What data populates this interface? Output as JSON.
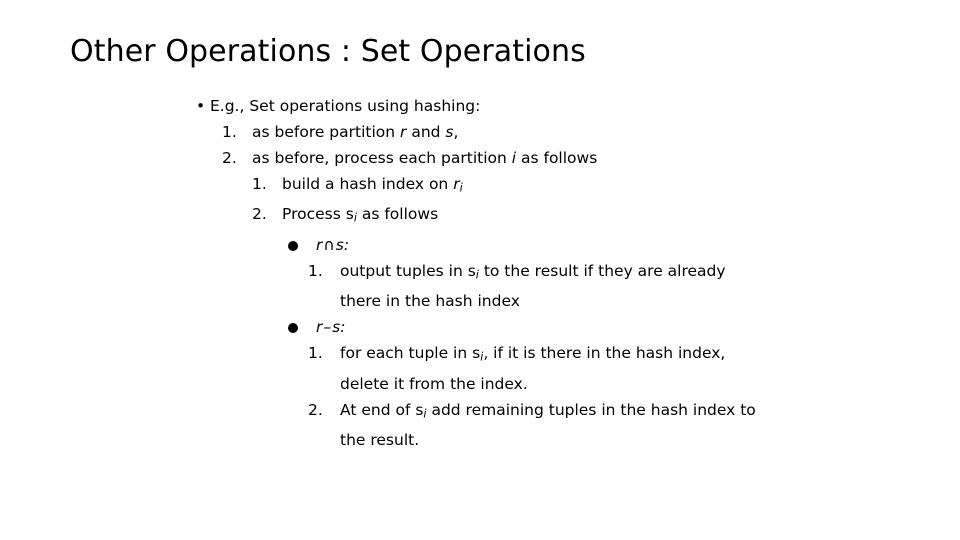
{
  "slide": {
    "title": "Other Operations : Set Operations",
    "background_color": "#ffffff",
    "text_color": "#000000"
  },
  "content": {
    "bullet_marker": "•",
    "disc_marker": "●",
    "items": [
      {
        "level": 1,
        "marker": "•",
        "text": "E.g., Set operations using hashing:"
      },
      {
        "level": 2,
        "marker": "1.",
        "text_prefix": "as before partition ",
        "var1": "r",
        "text_mid": " and ",
        "var2": "s",
        "text_suffix": ","
      },
      {
        "level": 2,
        "marker": "2.",
        "text_prefix": "as before, process each partition ",
        "var1": "i",
        "text_suffix": " as follows"
      },
      {
        "level": 3,
        "marker": "1.",
        "text_prefix": "build a hash index on ",
        "var1": "r",
        "sub1": "i",
        "text_suffix": ""
      },
      {
        "level": 3,
        "marker": "2.",
        "text_prefix": "Process s",
        "sub1": "i",
        "text_suffix": " as follows"
      },
      {
        "level": 4,
        "marker": "●",
        "var1": "r",
        "operator": "∩",
        "var2": "s",
        "text_suffix": ":"
      },
      {
        "level": 5,
        "marker": "1.",
        "text_prefix": "output tuples in s",
        "sub1": "i",
        "text_suffix": " to the result if they are already there in the hash index"
      },
      {
        "level": 4,
        "marker": "●",
        "var1": "r",
        "operator": "–",
        "var2": "s",
        "text_suffix": ":"
      },
      {
        "level": 5,
        "marker": "1.",
        "text_prefix": "for each tuple in s",
        "sub1": "i",
        "text_suffix": ", if it is there in the hash index, delete it from the index."
      },
      {
        "level": 5,
        "marker": "2.",
        "text_prefix": "At end of s",
        "sub1": "i",
        "text_suffix": " add remaining tuples in the hash index to the result."
      }
    ]
  }
}
